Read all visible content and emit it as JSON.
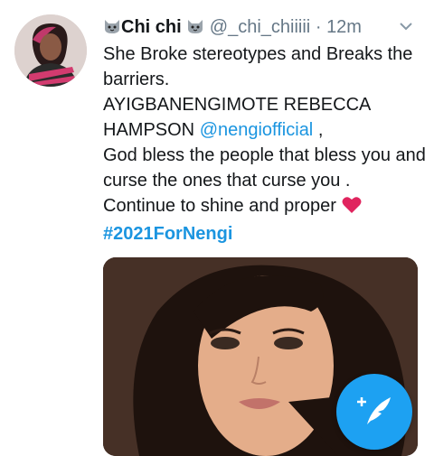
{
  "tweet": {
    "avatar_icon": "user-avatar-photo",
    "display_name": "Chi chi",
    "name_emoji_icon": "cat-face-icon",
    "handle": "@_chi_chiiiii",
    "separator": "·",
    "time": "12m",
    "more_icon": "chevron-down-icon",
    "text": {
      "line1": "She Broke stereotypes and Breaks the barriers.",
      "line2_name": "AYIGBANENGIMOTE REBECCA HAMPSON",
      "mention": "@nengiofficial",
      "line2_end": " ,",
      "line3": "God bless the people that bless you and curse the ones that curse you .",
      "line4": "Continue to shine and proper",
      "heart_icon": "red-heart-icon",
      "hashtag": "#2021ForNengi"
    },
    "media_icon": "attached-photo-portrait",
    "compose_button_icon": "compose-tweet-icon"
  },
  "colors": {
    "link": "#1b95e0",
    "muted": "#657786",
    "fab": "#1da1f2",
    "heart": "#e0245e"
  }
}
